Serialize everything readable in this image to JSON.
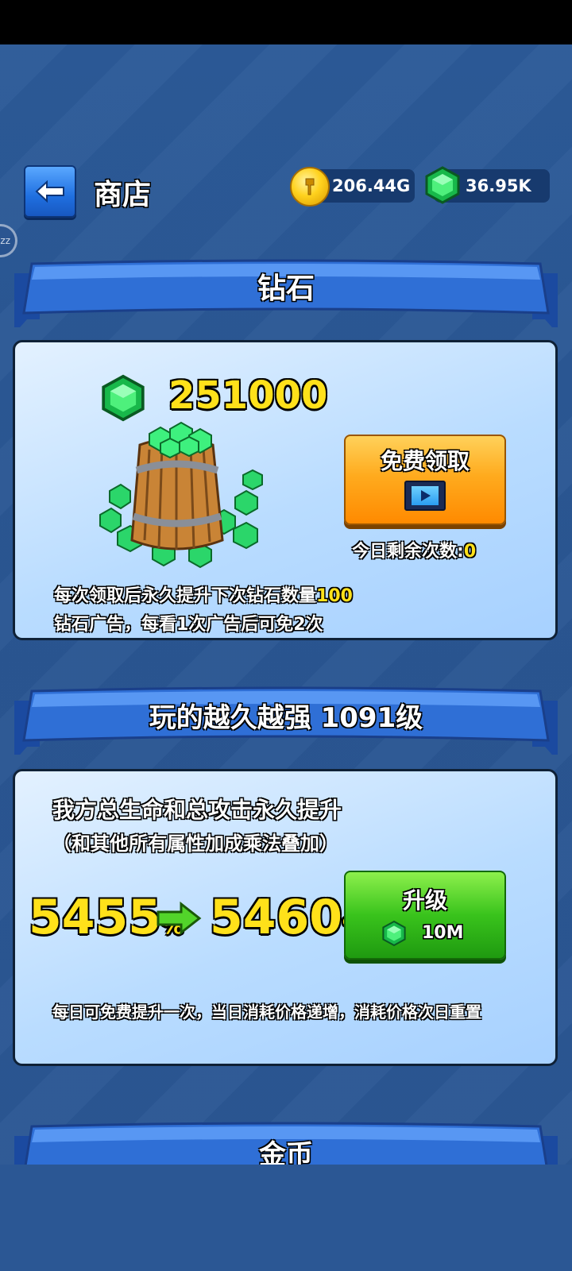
{
  "header": {
    "title": "商店",
    "gold": "206.44G",
    "gems": "36.95K"
  },
  "side_button": {
    "label": "zz"
  },
  "diamond_section": {
    "title": "钻石",
    "amount": "251000",
    "free_button_label": "免费领取",
    "remaining_label": "今日剩余次数:",
    "remaining_value": "0",
    "desc1": "每次领取后永久提升下次钻石数量",
    "desc1_value": "100",
    "desc2": "钻石广告，每看1次广告后可免2次"
  },
  "upgrade_section": {
    "title": "玩的越久越强 1091级",
    "heading": "我方总生命和总攻击永久提升",
    "subheading": "（和其他所有属性加成乘法叠加）",
    "current_value": "5455",
    "next_value": "5460",
    "percent_sign": "%",
    "button_label": "升级",
    "cost": "10M",
    "note": "每日可免费提升一次，当日消耗价格递增，消耗价格次日重置"
  },
  "gold_section": {
    "title": "金币"
  },
  "colors": {
    "background": "#2a5591",
    "ribbon": "#2f6fd6",
    "panel": "#b9dcff",
    "highlight_yellow": "#ffe11a",
    "button_orange": "#ff9a10",
    "button_green": "#39c31c"
  }
}
